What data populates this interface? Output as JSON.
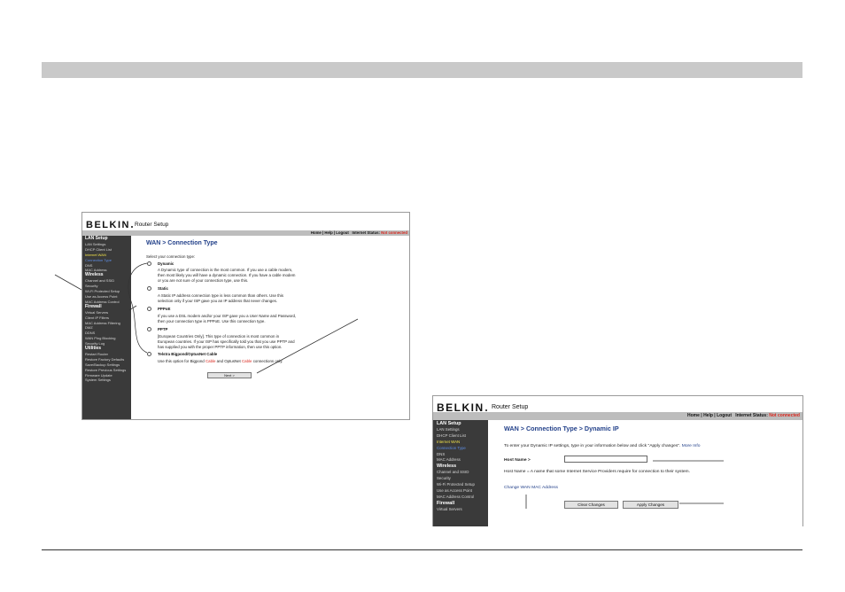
{
  "shot1": {
    "logo": "BELKIN",
    "title": "Router Setup",
    "top_links": "Home | Help | Logout",
    "status_label": "Internet Status:",
    "status_value": "Not connected",
    "sidebar": [
      {
        "label": "LAN Setup",
        "kind": "sec"
      },
      {
        "label": "LAN Settings",
        "kind": "item"
      },
      {
        "label": "DHCP Client List",
        "kind": "item"
      },
      {
        "label": "Internet WAN",
        "kind": "cur"
      },
      {
        "label": "Connection Type",
        "kind": "sel"
      },
      {
        "label": "DNS",
        "kind": "item"
      },
      {
        "label": "MAC Address",
        "kind": "item"
      },
      {
        "label": "Wireless",
        "kind": "sec"
      },
      {
        "label": "Channel and SSID",
        "kind": "item"
      },
      {
        "label": "Security",
        "kind": "item"
      },
      {
        "label": "Wi-Fi Protected Setup",
        "kind": "item"
      },
      {
        "label": "Use as Access Point",
        "kind": "item"
      },
      {
        "label": "MAC Address Control",
        "kind": "item"
      },
      {
        "label": "Firewall",
        "kind": "sec"
      },
      {
        "label": "Virtual Servers",
        "kind": "item"
      },
      {
        "label": "Client IP Filters",
        "kind": "item"
      },
      {
        "label": "MAC Address Filtering",
        "kind": "item"
      },
      {
        "label": "DMZ",
        "kind": "item"
      },
      {
        "label": "DDNS",
        "kind": "item"
      },
      {
        "label": "WAN Ping Blocking",
        "kind": "item"
      },
      {
        "label": "Security Log",
        "kind": "item"
      },
      {
        "label": "Utilities",
        "kind": "sec"
      },
      {
        "label": "Restart Router",
        "kind": "item"
      },
      {
        "label": "Restore Factory Defaults",
        "kind": "item"
      },
      {
        "label": "Save/Backup Settings",
        "kind": "item"
      },
      {
        "label": "Restore Previous Settings",
        "kind": "item"
      },
      {
        "label": "Firmware Update",
        "kind": "item"
      },
      {
        "label": "System Settings",
        "kind": "item"
      }
    ],
    "page_title": "WAN > Connection Type",
    "intro": "Select your connection type:",
    "options": [
      {
        "name": "Dynamic",
        "selected": true,
        "lines": [
          "A Dynamic type of connection is the most common. If you use a cable modem,",
          "then most likely you will have a dynamic connection. If you have a cable modem",
          "or you are not sure of your connection type, use this."
        ]
      },
      {
        "name": "Static",
        "selected": false,
        "lines": [
          "A Static IP address connection type is less common than others. Use this",
          "selection only if your ISP gave you an IP address that never changes."
        ]
      },
      {
        "name": "PPPoE",
        "selected": false,
        "lines": [
          "If you use a DSL modem and/or your ISP gave you a User Name and Password,",
          "then your connection type is PPPoE. Use this connection type."
        ]
      },
      {
        "name": "PPTP",
        "selected": false,
        "lines": [
          "[European Countries Only]. This type of connection is most common in",
          "European countries. If your ISP has specifically told you that you use PPTP and",
          "has supplied you with the proper PPTP information, then use this option."
        ]
      },
      {
        "name": "Telstra Bigpond/OptusNet Cable",
        "selected": false,
        "line_a": "Use this option for Bigpond ",
        "link_a": "Cable",
        "line_b": " and OptusNet ",
        "link_b": "Cable",
        "line_c": " connections only."
      }
    ],
    "next_button": "Next >"
  },
  "shot2": {
    "logo": "BELKIN",
    "title": "Router Setup",
    "top_links": "Home | Help | Logout",
    "status_label": "Internet Status:",
    "status_value": "Not connected",
    "sidebar": [
      {
        "label": "LAN Setup",
        "kind": "sec"
      },
      {
        "label": "LAN Settings",
        "kind": "item"
      },
      {
        "label": "DHCP Client List",
        "kind": "item"
      },
      {
        "label": "Internet WAN",
        "kind": "cur"
      },
      {
        "label": "Connection Type",
        "kind": "sel"
      },
      {
        "label": "DNS",
        "kind": "item"
      },
      {
        "label": "MAC Address",
        "kind": "item"
      },
      {
        "label": "Wireless",
        "kind": "sec"
      },
      {
        "label": "Channel and SSID",
        "kind": "item"
      },
      {
        "label": "Security",
        "kind": "item"
      },
      {
        "label": "Wi-Fi Protected Setup",
        "kind": "item"
      },
      {
        "label": "Use as Access Point",
        "kind": "item"
      },
      {
        "label": "MAC Address Control",
        "kind": "item"
      },
      {
        "label": "Firewall",
        "kind": "sec"
      },
      {
        "label": "Virtual Servers",
        "kind": "item"
      }
    ],
    "page_title": "WAN > Connection Type > Dynamic IP",
    "intro": "To enter your Dynamic IP settings, type in your information below and click \"Apply changes\".",
    "more_info": "More Info",
    "host_name_label": "Host Name >",
    "host_name_value": "",
    "host_name_note": "Host Name = A name that some Internet Service Providers require for connection to their system.",
    "change_mac_link": "Change WAN MAC Address",
    "clear_button": "Clear Changes",
    "apply_button": "Apply Changes"
  }
}
